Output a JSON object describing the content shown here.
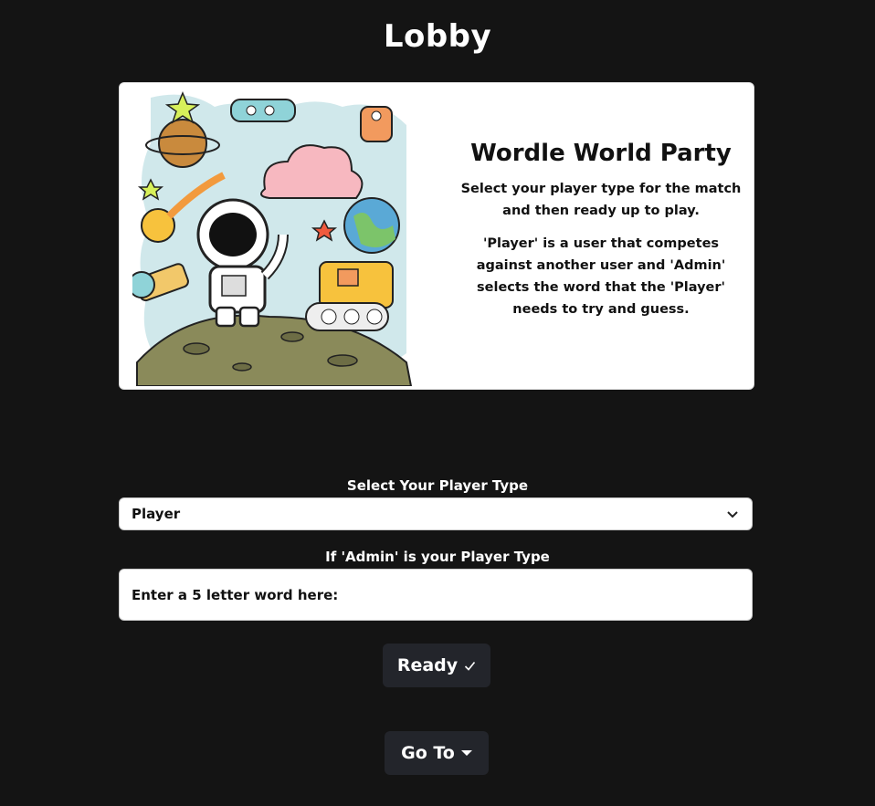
{
  "page": {
    "title": "Lobby"
  },
  "card": {
    "heading": "Wordle World Party",
    "paragraph1": "Select your player type for the match and then ready up to play.",
    "paragraph2": "'Player' is a user that competes against another user and 'Admin' selects the word that the 'Player' needs to try and guess."
  },
  "player_type": {
    "label": "Select Your Player Type",
    "selected": "Player"
  },
  "admin_word": {
    "label": "If 'Admin' is your Player Type",
    "placeholder": "Enter a 5 letter word here:"
  },
  "buttons": {
    "ready_label": "Ready",
    "goto_label": "Go To"
  },
  "icons": {
    "ready_icon": "check-icon",
    "goto_icon": "caret-down-icon",
    "select_icon": "chevron-down-icon"
  },
  "colors": {
    "background": "#141414",
    "button": "#23252b",
    "card": "#ffffff"
  }
}
